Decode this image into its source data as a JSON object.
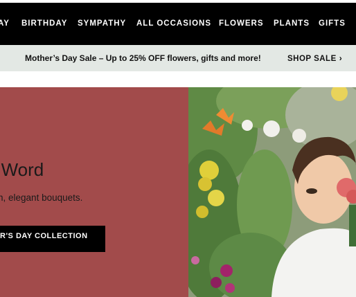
{
  "nav": {
    "items": [
      {
        "label": "AY"
      },
      {
        "label": "BIRTHDAY"
      },
      {
        "label": "SYMPATHY"
      },
      {
        "label": "ALL OCCASIONS"
      },
      {
        "label": "FLOWERS"
      },
      {
        "label": "PLANTS"
      },
      {
        "label": "GIFTS"
      }
    ]
  },
  "promo": {
    "text": "Mother’s Day Sale – Up to 25% OFF flowers, gifts and more!",
    "link": "SHOP SALE",
    "link_icon": "chevron-right-icon"
  },
  "hero": {
    "title": "s the Word",
    "subtitle": "t of fresh, elegant bouquets.",
    "button": "R'S DAY COLLECTION",
    "bg_color": "#a24b4b"
  }
}
